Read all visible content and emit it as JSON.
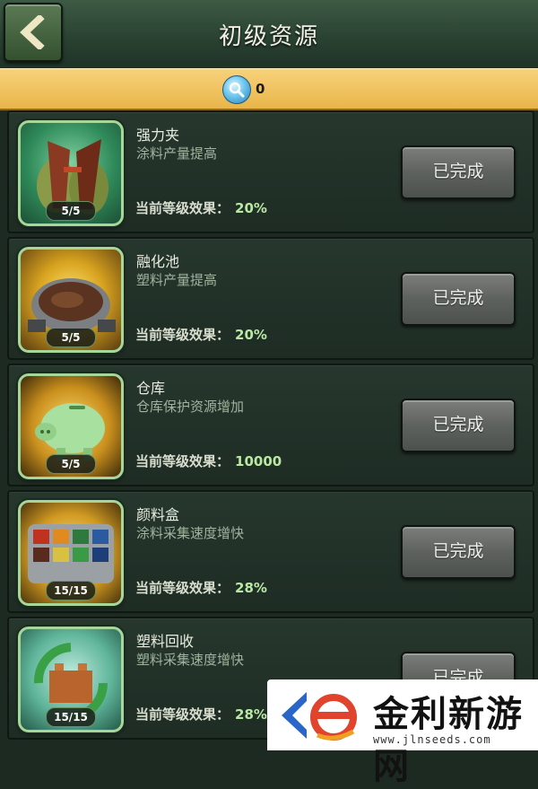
{
  "header": {
    "title": "初级资源",
    "back_icon": "chevron-left-icon"
  },
  "resource_bar": {
    "icon": "magnifier-gem-icon",
    "count": "0"
  },
  "common": {
    "effect_label": "当前等级效果：",
    "button_label": "已完成"
  },
  "items": [
    {
      "name": "强力夹",
      "desc": "涂料产量提高",
      "level": "5/5",
      "effect": "20%",
      "icon": "clamp-icon"
    },
    {
      "name": "融化池",
      "desc": "塑料产量提高",
      "level": "5/5",
      "effect": "20%",
      "icon": "melting-pot-icon"
    },
    {
      "name": "仓库",
      "desc": "仓库保护资源增加",
      "level": "5/5",
      "effect": "10000",
      "icon": "piggy-bank-icon"
    },
    {
      "name": "颜料盒",
      "desc": "涂料采集速度增快",
      "level": "15/15",
      "effect": "28%",
      "icon": "paint-box-icon"
    },
    {
      "name": "塑料回收",
      "desc": "塑料采集速度增快",
      "level": "15/15",
      "effect": "28%",
      "icon": "recycle-brick-icon"
    }
  ],
  "watermark": {
    "title": "金利新游网",
    "url": "www.jlnseeds.com"
  },
  "colors": {
    "header_bg": "#2a4232",
    "resource_bar_bg": "#f0c35f",
    "card_bg": "#22322a",
    "effect_value": "#b8e8a2",
    "button_bg": "#5e625e"
  }
}
